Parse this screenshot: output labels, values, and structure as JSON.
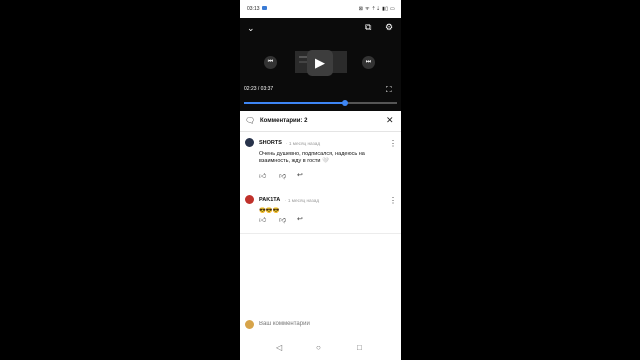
{
  "status_bar": {
    "time": "03:13",
    "indicators": "⊠ ᯤ ⇡⇣ ▮▯ ▭"
  },
  "player": {
    "icons": {
      "collapse": "chevron-down-icon",
      "cast": "cast-icon",
      "settings": "gear-icon",
      "previous": "skip-previous-icon",
      "play": "play-icon",
      "next": "skip-next-icon",
      "fullscreen": "fullscreen-icon"
    },
    "timecode": "02:23 / 03:37",
    "progress": 0.66,
    "accent_color": "#3e86f5"
  },
  "comments_panel": {
    "title": "Комментарии: 2",
    "comments": [
      {
        "author": "SHORTS",
        "meta": "· 1 месяц назад",
        "text": "Очень душевно, подписался, надеюсь на взаимность, жду в гости 🤍"
      },
      {
        "author": "PAK1TA",
        "meta": "· 1 месяц назад",
        "text": "😎😎😎"
      }
    ]
  },
  "compose": {
    "placeholder": "Ваш комментарий"
  }
}
